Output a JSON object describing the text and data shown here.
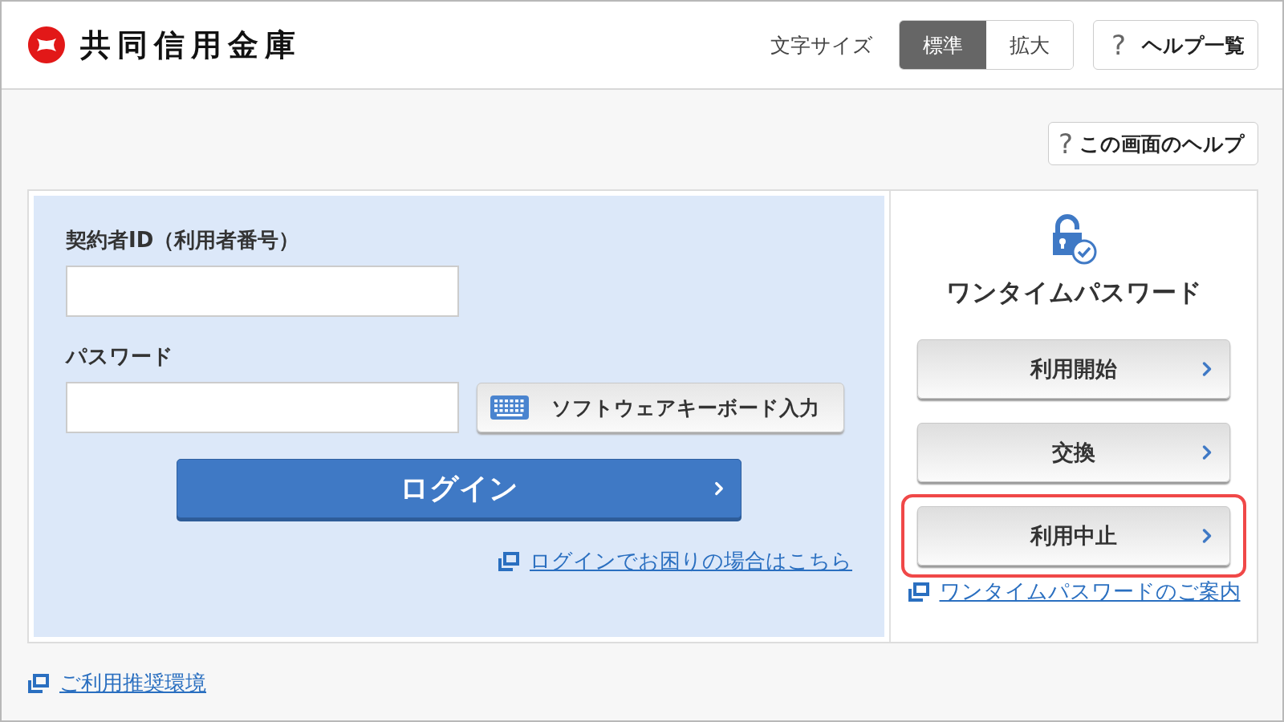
{
  "header": {
    "logo_text": "共同信用金庫",
    "font_size_label": "文字サイズ",
    "font_sizes": [
      {
        "label": "標準",
        "selected": true
      },
      {
        "label": "拡大",
        "selected": false
      }
    ],
    "help_button": {
      "icon_text": "?",
      "label": "ヘルプ一覧"
    }
  },
  "screen_help_button": {
    "icon_text": "?",
    "label": "この画面のヘルプ"
  },
  "login": {
    "id_label": "契約者ID（利用者番号）",
    "password_label": "パスワード",
    "keyboard_button": "ソフトウェアキーボード入力",
    "login_button": "ログイン",
    "help_link": "ログインでお困りの場合はこちら"
  },
  "one_time_password": {
    "title": "ワンタイムパスワード",
    "buttons": [
      {
        "label": "利用開始",
        "highlighted": false
      },
      {
        "label": "交換",
        "highlighted": false
      },
      {
        "label": "利用中止",
        "highlighted": true
      }
    ],
    "guide_link": "ワンタイムパスワードのご案内"
  },
  "footer_link": "ご利用推奨環境"
}
